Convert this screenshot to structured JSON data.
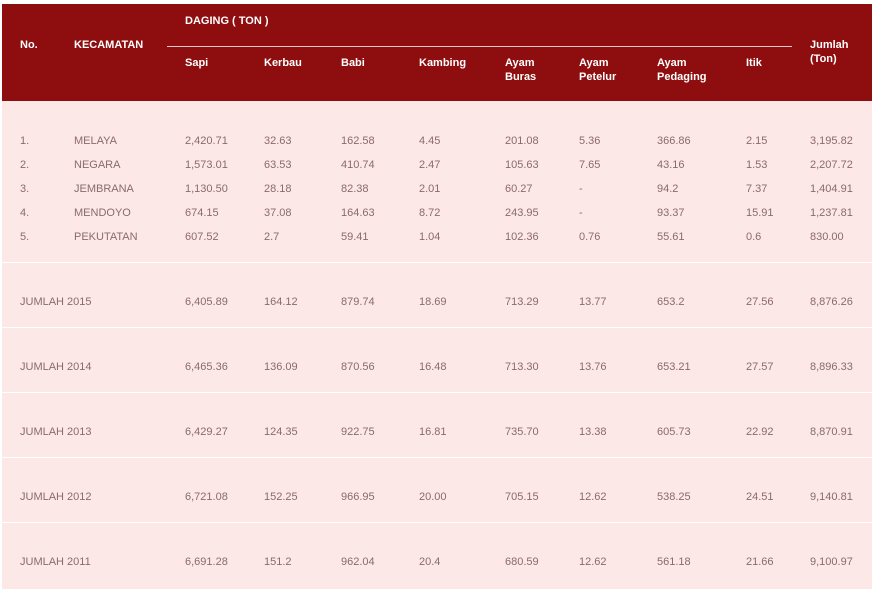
{
  "header": {
    "no": "No.",
    "kecamatan": "KECAMATAN",
    "group": "DAGING ( TON )",
    "sapi": "Sapi",
    "kerbau": "Kerbau",
    "babi": "Babi",
    "kambing": "Kambing",
    "ayam_buras": [
      "Ayam",
      "Buras"
    ],
    "ayam_petelur": [
      "Ayam",
      "Petelur"
    ],
    "ayam_pedaging": [
      "Ayam",
      "Pedaging"
    ],
    "itik": "Itik",
    "jumlah": [
      "Jumlah",
      "(Ton)"
    ]
  },
  "rows": [
    [
      "1.",
      "MELAYA",
      "2,420.71",
      "32.63",
      "162.58",
      "4.45",
      "201.08",
      "5.36",
      "366.86",
      "2.15",
      "3,195.82"
    ],
    [
      "2.",
      "NEGARA",
      "1,573.01",
      "63.53",
      "410.74",
      "2.47",
      "105.63",
      "7.65",
      "43.16",
      "1.53",
      "2,207.72"
    ],
    [
      "3.",
      "JEMBRANA",
      "1,130.50",
      "28.18",
      "82.38",
      "2.01",
      "60.27",
      "-",
      "94.2",
      "7.37",
      "1,404.91"
    ],
    [
      "4.",
      "MENDOYO",
      "674.15",
      "37.08",
      "164.63",
      "8.72",
      "243.95",
      "-",
      "93.37",
      "15.91",
      "1,237.81"
    ],
    [
      "5.",
      "PEKUTATAN",
      "607.52",
      "2.7",
      "59.41",
      "1.04",
      "102.36",
      "0.76",
      "55.61",
      "0.6",
      "830.00"
    ]
  ],
  "totals": [
    [
      "JUMLAH 2015",
      "6,405.89",
      "164.12",
      "879.74",
      "18.69",
      "713.29",
      "13.77",
      "653.2",
      "27.56",
      "8,876.26"
    ],
    [
      "JUMLAH 2014",
      "6,465.36",
      "136.09",
      "870.56",
      "16.48",
      "713.30",
      "13.76",
      "653.21",
      "27.57",
      "8,896.33"
    ],
    [
      "JUMLAH 2013",
      "6,429.27",
      "124.35",
      "922.75",
      "16.81",
      "735.70",
      "13.38",
      "605.73",
      "22.92",
      "8,870.91"
    ],
    [
      "JUMLAH 2012",
      "6,721.08",
      "152.25",
      "966.95",
      "20.00",
      "705.15",
      "12.62",
      "538.25",
      "24.51",
      "9,140.81"
    ],
    [
      "JUMLAH 2011",
      "6,691.28",
      "151.2",
      "962.04",
      "20.4",
      "680.59",
      "12.62",
      "561.18",
      "21.66",
      "9,100.97"
    ]
  ],
  "colors": {
    "header_bg": "#8e0d0e",
    "body_bg": "#fde8e8",
    "text": "#8a6a6a"
  }
}
